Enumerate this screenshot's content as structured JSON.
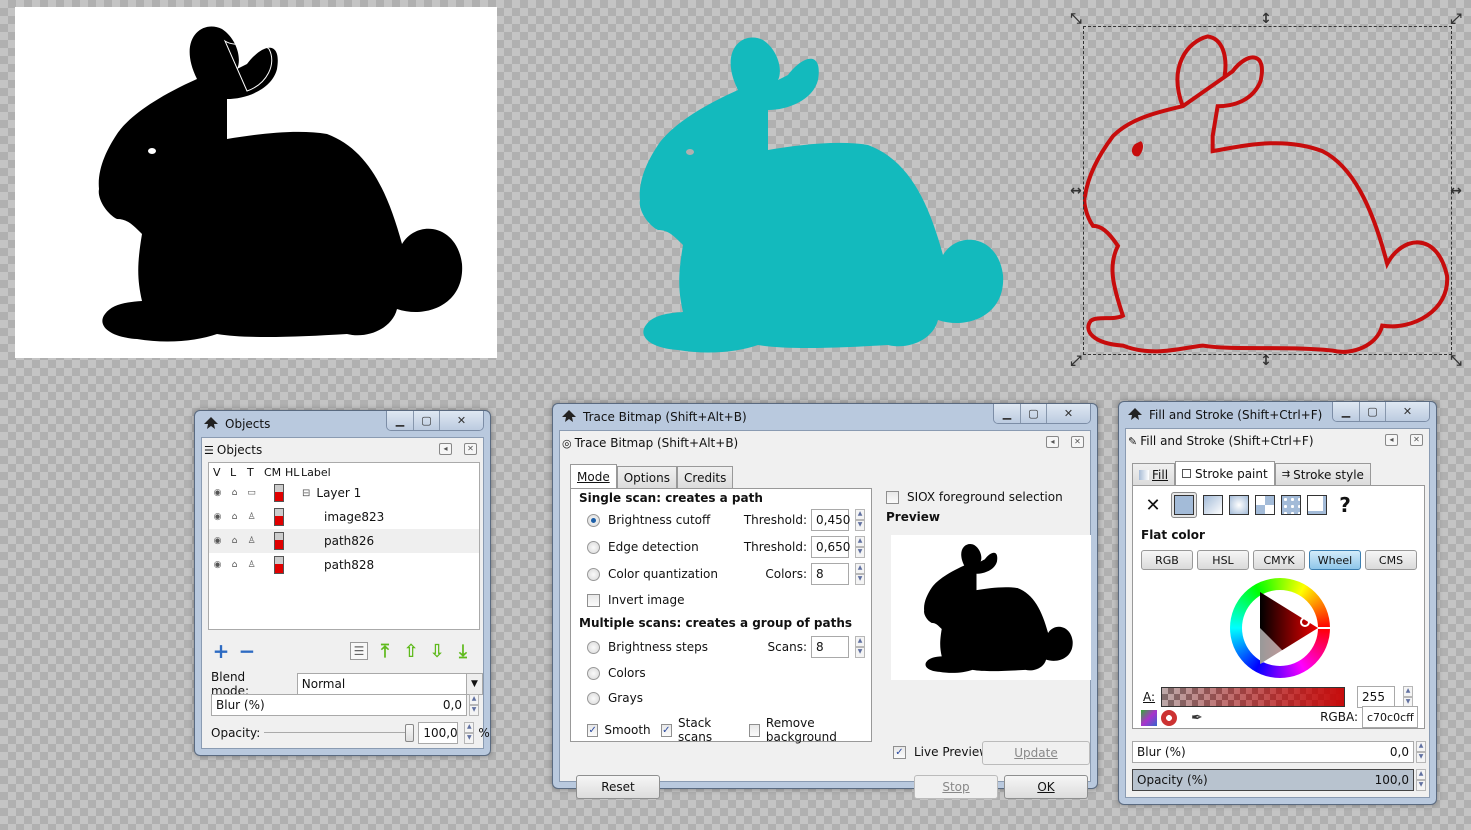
{
  "canvas": {
    "objects": [
      {
        "name": "image823",
        "kind": "bitmap",
        "fill": "#000000",
        "background": "#ffffff"
      },
      {
        "name": "path826",
        "kind": "path",
        "fill": "#13babd"
      },
      {
        "name": "path828",
        "kind": "path",
        "stroke": "#c70c0c",
        "selected": true
      }
    ],
    "handle_glyphs": {
      "corner_nw": "⤡",
      "corner_ne": "⤢",
      "corner_sw": "⤢",
      "corner_se": "⤡",
      "vertical": "↕",
      "horizontal": "↔"
    }
  },
  "objects_window": {
    "title": "Objects",
    "panel_title": "Objects",
    "controls": {
      "minimize": "▁",
      "maximize": "▢",
      "close": "✕"
    },
    "columns": [
      "V",
      "L",
      "T",
      "CM",
      "HL",
      "Label"
    ],
    "rows": [
      {
        "label": "Layer 1",
        "expander": "⊟",
        "type_icon": "layer",
        "visible_icon": "👁",
        "lock_icon": "🔓",
        "level": 0
      },
      {
        "label": "image823",
        "type_icon": "object",
        "level": 1
      },
      {
        "label": "path826",
        "type_icon": "object",
        "level": 1,
        "highlighted": true
      },
      {
        "label": "path828",
        "type_icon": "object",
        "level": 1
      }
    ],
    "toolbar": {
      "add": "+",
      "remove": "−",
      "props": "☰",
      "top": "⤒",
      "up": "⇧",
      "down": "⇩",
      "bottom": "⤓"
    },
    "blend_mode_label": "Blend mode:",
    "blend_mode_value": "Normal",
    "blur_label": "Blur (%)",
    "blur_value": "0,0",
    "opacity_label": "Opacity:",
    "opacity_value": "100,0",
    "opacity_unit": "%",
    "opacity_fraction": 1.0
  },
  "trace_window": {
    "title": "Trace Bitmap (Shift+Alt+B)",
    "panel_title": "Trace Bitmap (Shift+Alt+B)",
    "tabs": [
      "Mode",
      "Options",
      "Credits"
    ],
    "active_tab": "Mode",
    "single_scan_heading": "Single scan: creates a path",
    "brightness_cutoff": {
      "label": "Brightness cutoff",
      "selected": true,
      "param_label": "Threshold:",
      "value": "0,450"
    },
    "edge_detection": {
      "label": "Edge detection",
      "selected": false,
      "param_label": "Threshold:",
      "value": "0,650"
    },
    "color_quantization": {
      "label": "Color quantization",
      "selected": false,
      "param_label": "Colors:",
      "value": "8"
    },
    "invert_image": {
      "label": "Invert image",
      "checked": false
    },
    "multi_scan_heading": "Multiple scans: creates a group of paths",
    "brightness_steps": {
      "label": "Brightness steps",
      "selected": false,
      "param_label": "Scans:",
      "value": "8"
    },
    "colors": {
      "label": "Colors",
      "selected": false
    },
    "grays": {
      "label": "Grays",
      "selected": false
    },
    "smooth": {
      "label": "Smooth",
      "checked": true
    },
    "stack_scans": {
      "label": "Stack scans",
      "checked": true
    },
    "remove_background": {
      "label": "Remove background",
      "checked": false
    },
    "siox": {
      "label": "SIOX foreground selection",
      "checked": false
    },
    "preview_heading": "Preview",
    "live_preview": {
      "label": "Live Preview",
      "checked": true
    },
    "buttons": {
      "update": "Update",
      "reset": "Reset",
      "stop": "Stop",
      "ok": "OK"
    }
  },
  "fill_stroke_window": {
    "title": "Fill and Stroke (Shift+Ctrl+F)",
    "panel_title": "Fill and Stroke (Shift+Ctrl+F)",
    "tabs": [
      "Fill",
      "Stroke paint",
      "Stroke style"
    ],
    "active_tab": "Stroke paint",
    "paint_types": [
      "none",
      "flat",
      "linear",
      "radial",
      "pattern",
      "swatch",
      "unset"
    ],
    "paint_none_glyph": "✕",
    "paint_unset_glyph": "?",
    "active_paint": "flat",
    "flat_color_label": "Flat color",
    "color_modes": [
      "RGB",
      "HSL",
      "CMYK",
      "Wheel",
      "CMS"
    ],
    "active_mode": "Wheel",
    "alpha_label": "A:",
    "alpha_value": "255",
    "rgba_label": "RGBA:",
    "rgba_value": "c70c0cff",
    "color_hex": "#c70c0c",
    "blur_label": "Blur (%)",
    "blur_value": "0,0",
    "opacity_label": "Opacity (%)",
    "opacity_value": "100,0"
  }
}
